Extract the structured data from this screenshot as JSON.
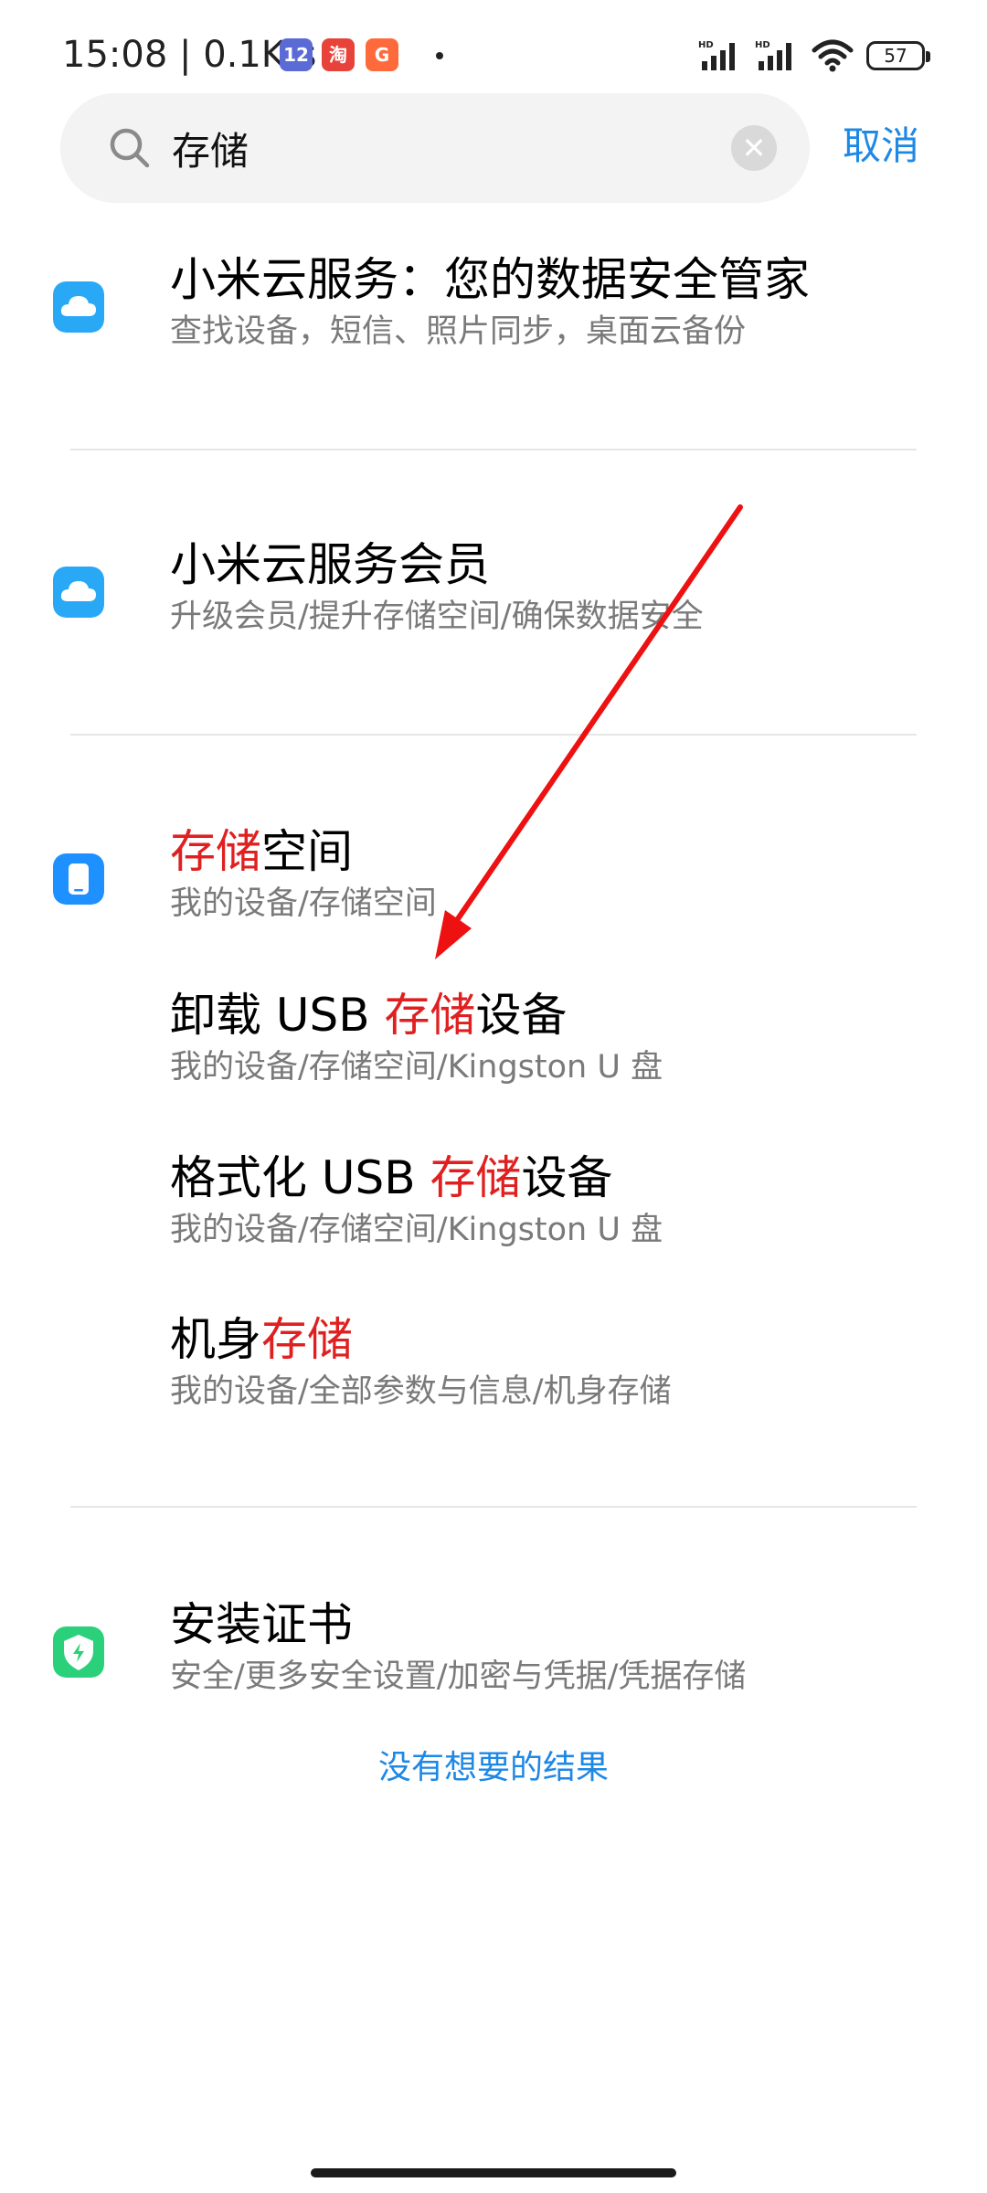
{
  "status_bar": {
    "time": "15:08",
    "speed": "0.1K/s",
    "app_icons": [
      "12",
      "淘",
      "G"
    ],
    "signal_badges": [
      "HD",
      "HD"
    ],
    "battery": "57"
  },
  "search": {
    "query": "存储",
    "clear_icon": "close-icon",
    "cancel_label": "取消"
  },
  "results": [
    {
      "icon": "cloud-icon",
      "title": [
        "小米云服务：您的数据安全管家"
      ],
      "subtitle": "查找设备，短信、照片同步，桌面云备份"
    },
    {
      "icon": "cloud-icon",
      "title": [
        "小米云服务会员"
      ],
      "subtitle": "升级会员/提升存储空间/确保数据安全"
    },
    {
      "icon": "phone-storage-icon",
      "title": [
        "",
        "存储",
        "空间"
      ],
      "subtitle": "我的设备/存储空间"
    },
    {
      "title": [
        "卸载 USB ",
        "存储",
        "设备"
      ],
      "subtitle": "我的设备/存储空间/Kingston U 盘"
    },
    {
      "title": [
        "格式化 USB ",
        "存储",
        "设备"
      ],
      "subtitle": "我的设备/存储空间/Kingston U 盘"
    },
    {
      "title": [
        "机身",
        "存储"
      ],
      "subtitle": "我的设备/全部参数与信息/机身存储"
    },
    {
      "icon": "shield-icon",
      "title": [
        "安装证书"
      ],
      "subtitle": "安全/更多安全设置/加密与凭据/凭据存储"
    }
  ],
  "no_result_link": "没有想要的结果",
  "colors": {
    "accent_blue": "#1e88e5",
    "highlight_red": "#e02020",
    "cloud_blue": "#29a9f5",
    "storage_blue": "#1e90ff",
    "security_green": "#2bd07a",
    "annotation_arrow": "#ee1111"
  }
}
